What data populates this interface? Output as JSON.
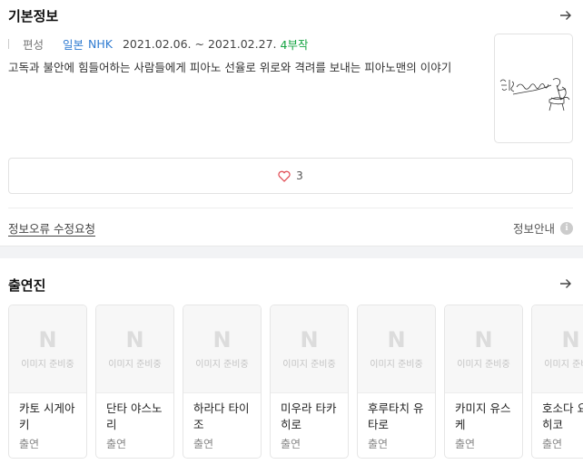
{
  "basic_info": {
    "title": "기본정보",
    "category_label": "편성",
    "country": "일본",
    "channel": "NHK",
    "date_range": "2021.02.06. ~ 2021.02.27.",
    "episodes": "4부작",
    "description": "고독과 불안에 힘들어하는 사람들에게 피아노 선율로 위로와 격려를 보내는 피아노맨의 이야기",
    "like_count": "3",
    "report_link": "정보오류 수정요청",
    "info_guide": "정보안내",
    "info_icon_glyph": "i"
  },
  "cast_section": {
    "title": "출연진",
    "placeholder_logo": "N",
    "placeholder_text": "이미지 준비중",
    "members": [
      {
        "name": "카토 시게아키",
        "role": "출연"
      },
      {
        "name": "단타 야스노리",
        "role": "출연"
      },
      {
        "name": "하라다 타이조",
        "role": "출연"
      },
      {
        "name": "미우라 타카히로",
        "role": "출연"
      },
      {
        "name": "후루타치 유타로",
        "role": "출연"
      },
      {
        "name": "카미지 유스케",
        "role": "출연"
      },
      {
        "name": "호소다 요시히코",
        "role": "출연"
      }
    ]
  },
  "colors": {
    "link_blue": "#2f7bd1",
    "episode_green": "#14a341",
    "heart_red": "#e0454e"
  },
  "icons": [
    "arrow-right-icon",
    "heart-icon",
    "info-icon",
    "n-logo-placeholder"
  ]
}
